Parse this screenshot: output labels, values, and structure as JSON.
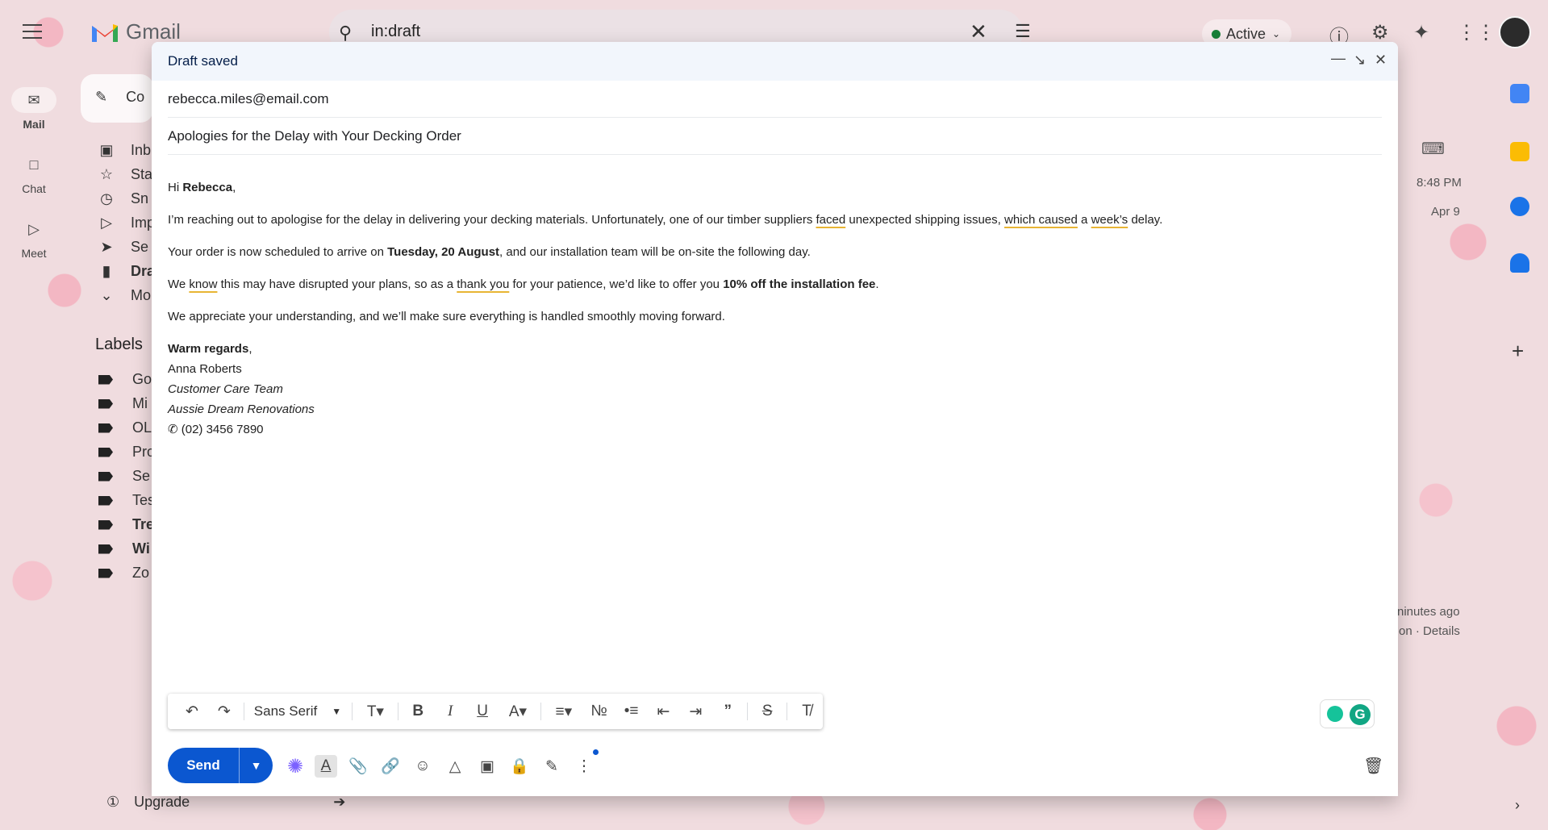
{
  "app": {
    "logo_text": "Gmail",
    "search_query": "in:draft",
    "status": "Active"
  },
  "rail": {
    "items": [
      {
        "label": "Mail",
        "icon": "mail-icon"
      },
      {
        "label": "Chat",
        "icon": "chat-icon"
      },
      {
        "label": "Meet",
        "icon": "video-icon"
      }
    ]
  },
  "nav": {
    "compose_label": "Co",
    "items": [
      "Inb",
      "Sta",
      "Sn",
      "Imp",
      "Se",
      "Dra",
      "Mo"
    ],
    "labels_title": "Labels",
    "labels": [
      "Go",
      "Mi",
      "OL",
      "Pro",
      "Se",
      "Tes",
      "Tre",
      "Wi",
      "Zo"
    ],
    "upgrade": "Upgrade"
  },
  "background_list": {
    "time1": "8:48 PM",
    "time2": "Apr 9",
    "activity1": "ninutes ago",
    "activity2": "on · Details"
  },
  "compose": {
    "title": "Draft saved",
    "to": "rebecca.miles@email.com",
    "subject": "Apologies for the Delay with Your Decking Order",
    "greeting_prefix": "Hi ",
    "greeting_name": "Rebecca",
    "greeting_suffix": ",",
    "p1_a": "I’m reaching out to apologise for the delay in delivering your decking materials. Unfortunately, one of our timber suppliers ",
    "p1_u1": "faced",
    "p1_b": " unexpected shipping issues, ",
    "p1_u2": "which caused",
    "p1_c": " a ",
    "p1_u3": "week’s",
    "p1_d": " delay.",
    "p2_a": "Your order is now scheduled to arrive on ",
    "p2_bold": "Tuesday, 20 August",
    "p2_b": ", and our installation team will be on-site the following day.",
    "p3_a": "We ",
    "p3_u1": "know",
    "p3_b": " this may have disrupted your plans, so as a ",
    "p3_u2": "thank you",
    "p3_c": " for your patience, we’d like to offer you ",
    "p3_bold": "10% off the installation fee",
    "p3_d": ".",
    "p4": "We appreciate your understanding, and we’ll make sure everything is handled smoothly moving forward.",
    "sig_regards": "Warm regards",
    "sig_comma": ",",
    "sig_name": "Anna Roberts",
    "sig_team": "Customer Care Team",
    "sig_company": "Aussie Dream Renovations",
    "sig_phone": "(02) 3456 7890",
    "font_name": "Sans Serif",
    "send_label": "Send"
  }
}
